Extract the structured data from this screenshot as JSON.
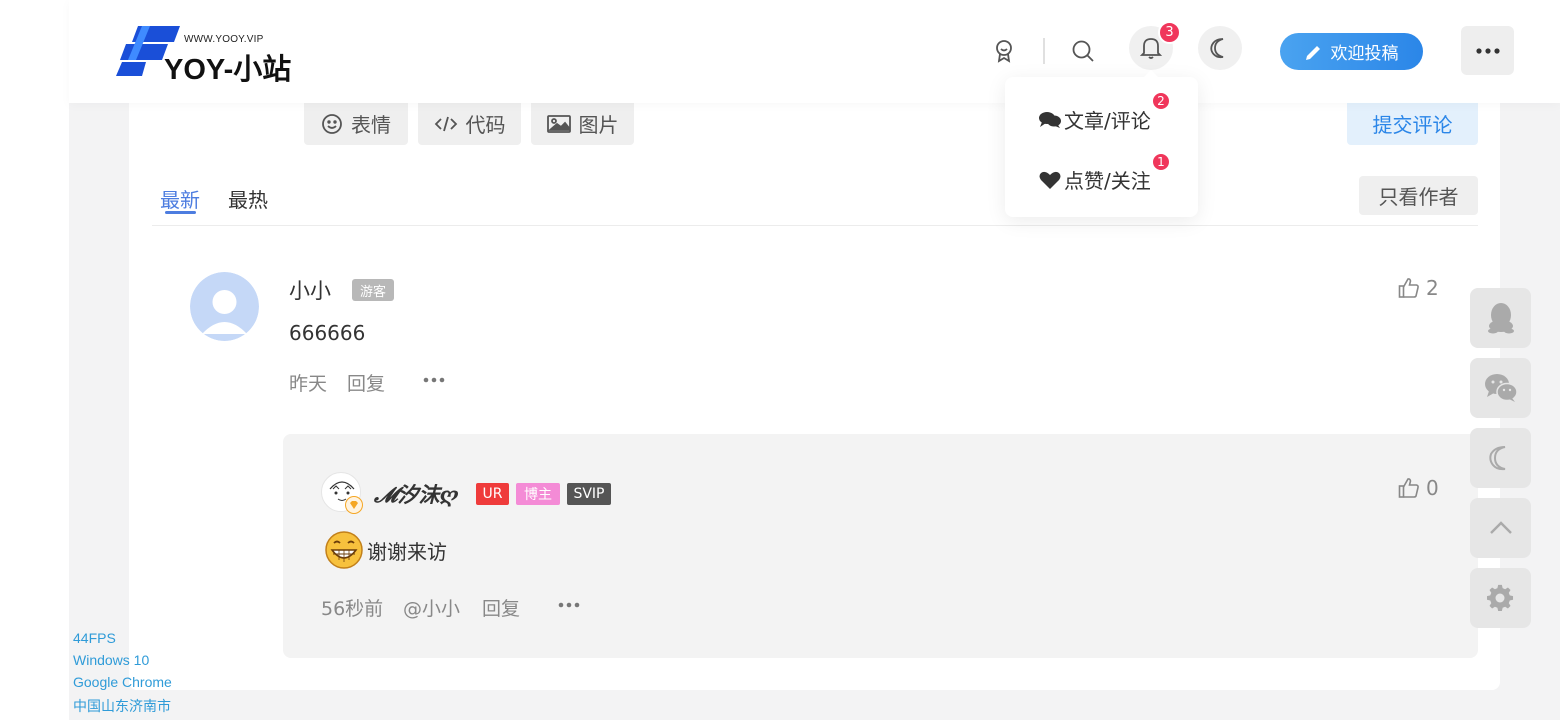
{
  "header": {
    "logo_small": "WWW.YOOY.VIP",
    "logo_text": "YOY-小站",
    "notification_count": "3",
    "submit_post_label": "欢迎投稿"
  },
  "notifications": {
    "items": [
      {
        "label": "文章/评论",
        "count": "2",
        "icon": "comments-icon"
      },
      {
        "label": "点赞/关注",
        "count": "1",
        "icon": "heart-icon"
      }
    ]
  },
  "editor": {
    "emoji_label": "表情",
    "code_label": "代码",
    "image_label": "图片",
    "submit_label": "提交评论"
  },
  "tabs": {
    "newest": "最新",
    "hottest": "最热",
    "author_only": "只看作者"
  },
  "comments": [
    {
      "author": "小小",
      "badge": "游客",
      "text": "666666",
      "time": "昨天",
      "reply_label": "回复",
      "likes": "2"
    }
  ],
  "reply": {
    "author": "𝓜汐沫ღ",
    "tags": [
      "UR",
      "博主",
      "SVIP"
    ],
    "text": "谢谢来访",
    "time": "56秒前",
    "mention": "@小小",
    "reply_label": "回复",
    "likes": "0"
  },
  "debug": {
    "fps": "44FPS",
    "os": "Windows 10",
    "browser": "Google Chrome",
    "location": "中国山东济南市"
  },
  "colors": {
    "accent": "#4d7de0",
    "badge_red": "#f0365b",
    "submit_blue": "#2b86e8"
  }
}
